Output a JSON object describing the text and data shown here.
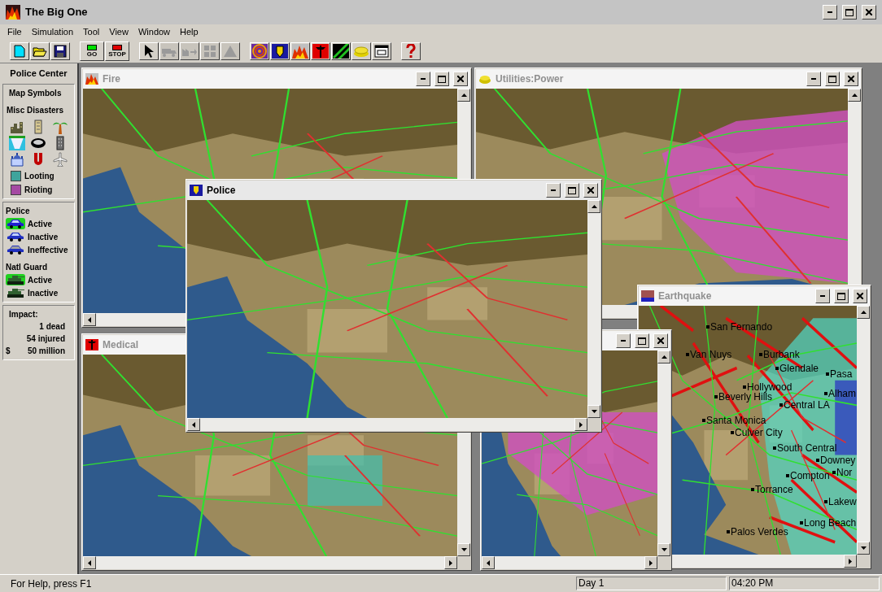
{
  "window": {
    "title": "The Big One"
  },
  "menu": [
    "File",
    "Simulation",
    "Tool",
    "View",
    "Window",
    "Help"
  ],
  "toolbar": [
    [
      {
        "kind": "new",
        "disabled": false
      },
      {
        "kind": "open",
        "disabled": false
      },
      {
        "kind": "save",
        "disabled": false
      }
    ],
    [
      {
        "kind": "go",
        "label": "GO",
        "disabled": false
      },
      {
        "kind": "stop",
        "label": "STOP",
        "disabled": false
      }
    ],
    [
      {
        "kind": "pointer",
        "disabled": false
      },
      {
        "kind": "truck",
        "disabled": true
      },
      {
        "kind": "move",
        "disabled": true
      },
      {
        "kind": "grid",
        "disabled": true
      },
      {
        "kind": "tent",
        "disabled": true
      }
    ],
    [
      {
        "kind": "quake",
        "disabled": false
      },
      {
        "kind": "police",
        "disabled": false
      },
      {
        "kind": "fire",
        "disabled": false
      },
      {
        "kind": "medical",
        "disabled": false
      },
      {
        "kind": "power",
        "disabled": false
      },
      {
        "kind": "bread",
        "disabled": false
      },
      {
        "kind": "window",
        "disabled": false
      }
    ],
    [
      {
        "kind": "help",
        "disabled": false
      }
    ]
  ],
  "sidebar": {
    "title": "Police Center",
    "map_symbols": {
      "title": "Map Symbols",
      "misc_title": "Misc Disasters",
      "areas": [
        {
          "label": "Looting",
          "color": "#3fa49c"
        },
        {
          "label": "Rioting",
          "color": "#a54aa3"
        }
      ]
    },
    "units": [
      {
        "title": "Police",
        "items": [
          {
            "label": "Active",
            "kind": "active_car"
          },
          {
            "label": "Inactive",
            "kind": "car"
          },
          {
            "label": "Ineffective",
            "kind": "ineffective_car"
          }
        ]
      },
      {
        "title": "Natl Guard",
        "items": [
          {
            "label": "Active",
            "kind": "active_tank"
          },
          {
            "label": "Inactive",
            "kind": "tank"
          }
        ]
      }
    ],
    "impact": {
      "title": "Impact:",
      "rows": [
        {
          "value": "1 dead"
        },
        {
          "value": "54 injured"
        },
        {
          "prefix": "$",
          "value": "50 million"
        }
      ]
    }
  },
  "child_windows": [
    {
      "kind": "fire",
      "title": "Fire",
      "selected": false
    },
    {
      "kind": "power",
      "title": "Utilities:Power",
      "selected": false
    },
    {
      "kind": "medical",
      "title": "Medical",
      "selected": false
    },
    {
      "kind": "quake",
      "title": "Earthquake",
      "selected": false,
      "places": [
        "San Fernando",
        "Van Nuys",
        "Burbank",
        "Glendale",
        "Pasa",
        "Hollywood",
        "Beverly Hills",
        "Alham",
        "Central LA",
        "Santa Monica",
        "Culver City",
        "South Central",
        "Downey",
        "Compton",
        "Nor",
        "Torrance",
        "Lakew",
        "Long Beach",
        "Palos Verdes"
      ]
    },
    {
      "kind": "blank",
      "selected": false
    },
    {
      "kind": "police",
      "title": "Police",
      "selected": true
    }
  ],
  "status_bar": {
    "help": "For Help, press F1",
    "day": "Day 1",
    "time": "04:20 PM"
  }
}
